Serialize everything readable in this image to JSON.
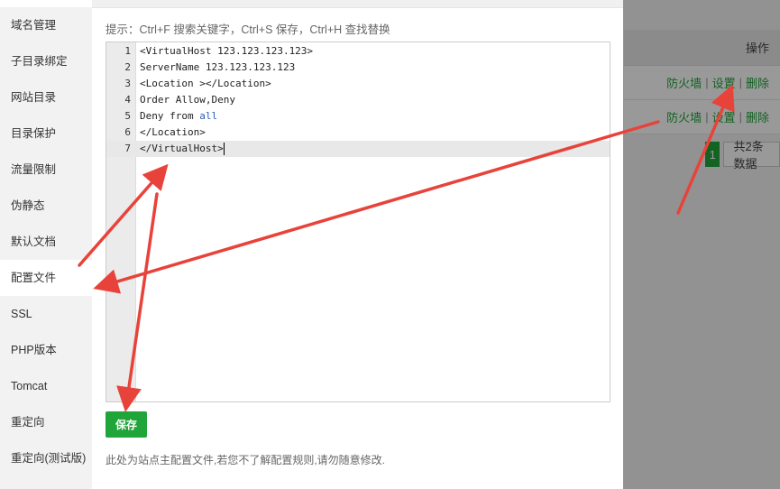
{
  "sidebar": {
    "items": [
      {
        "label": "域名管理"
      },
      {
        "label": "子目录绑定"
      },
      {
        "label": "网站目录"
      },
      {
        "label": "目录保护"
      },
      {
        "label": "流量限制"
      },
      {
        "label": "伪静态"
      },
      {
        "label": "默认文档"
      },
      {
        "label": "配置文件",
        "active": true
      },
      {
        "label": "SSL"
      },
      {
        "label": "PHP版本"
      },
      {
        "label": "Tomcat"
      },
      {
        "label": "重定向"
      },
      {
        "label": "重定向(测试版)"
      }
    ]
  },
  "editor": {
    "hint": "提示：Ctrl+F 搜索关键字，Ctrl+S 保存，Ctrl+H 查找替换",
    "lines": [
      {
        "num": "1",
        "text": "<VirtualHost 123.123.123.123>"
      },
      {
        "num": "2",
        "text": "ServerName 123.123.123.123"
      },
      {
        "num": "3",
        "text": "<Location ></Location>"
      },
      {
        "num": "4",
        "text": "Order Allow,Deny"
      },
      {
        "num": "5",
        "text_before": "Deny from ",
        "text_keyword": "all"
      },
      {
        "num": "6",
        "text": "</Location>"
      },
      {
        "num": "7",
        "text": "</VirtualHost>",
        "active": true
      }
    ]
  },
  "save_label": "保存",
  "note": "此处为站点主配置文件,若您不了解配置规则,请勿随意修改.",
  "background": {
    "header_action": "操作",
    "rows": [
      {
        "firewall": "防火墙",
        "settings": "设置",
        "delete": "删除"
      },
      {
        "firewall": "防火墙",
        "settings": "设置",
        "delete": "删除"
      }
    ],
    "pager_current": "1",
    "pager_total": "共2条数据"
  },
  "colors": {
    "accent": "#20a53a",
    "arrow": "#e8433a",
    "keyword": "#2a5db0"
  }
}
